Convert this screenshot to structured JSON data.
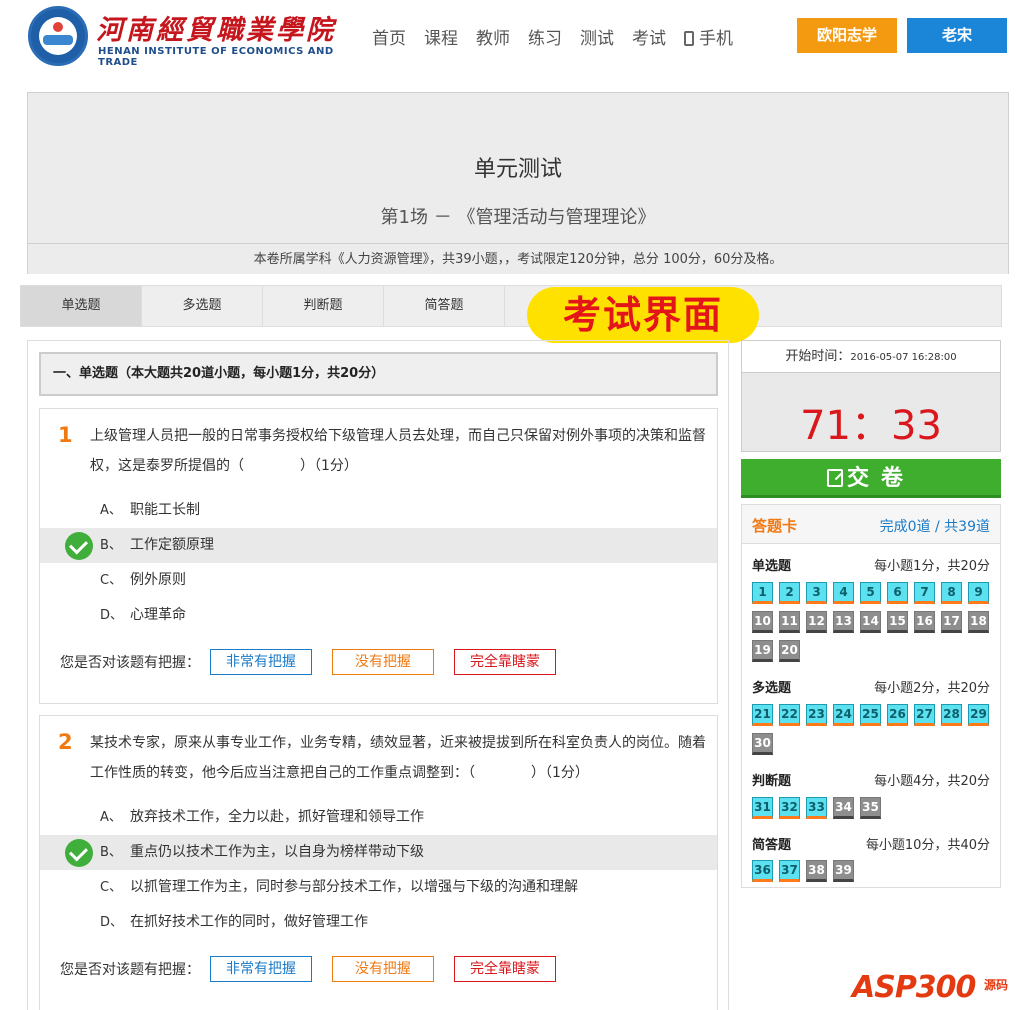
{
  "header": {
    "logo_cn": "河南經貿職業學院",
    "logo_en": "HENAN INSTITUTE OF ECONOMICS AND TRADE",
    "nav": [
      "首页",
      "课程",
      "教师",
      "练习",
      "测试",
      "考试",
      "手机"
    ],
    "user_btn1": "欧阳志学",
    "user_btn2": "老宋",
    "accent_orange": "#f39a11",
    "accent_blue": "#1b86d8"
  },
  "exam": {
    "title": "单元测试",
    "subtitle": "第1场 － 《管理活动与管理理论》",
    "info": "本卷所属学科《人力资源管理》，共39小题，，考试限定120分钟，总分 100分，60分及格。"
  },
  "tabs": [
    "单选题",
    "多选题",
    "判断题",
    "简答题"
  ],
  "overlay_label": "考试界面",
  "section_head": "一、单选题（本大题共20道小题，每小题1分，共20分）",
  "questions": [
    {
      "num": "1",
      "text": "上级管理人员把一般的日常事务授权给下级管理人员去处理，而自己只保留对例外事项的决策和监督权，这是泰罗所提倡的（　　　　）（1分）",
      "options": [
        {
          "letter": "A、",
          "text": "职能工长制"
        },
        {
          "letter": "B、",
          "text": "工作定额原理"
        },
        {
          "letter": "C、",
          "text": "例外原则"
        },
        {
          "letter": "D、",
          "text": "心理革命"
        }
      ]
    },
    {
      "num": "2",
      "text": "某技术专家，原来从事专业工作，业务专精，绩效显著，近来被提拔到所在科室负责人的岗位。随着工作性质的转变，他今后应当注意把自己的工作重点调整到：（　　　　）（1分）",
      "options": [
        {
          "letter": "A、",
          "text": "放弃技术工作，全力以赴，抓好管理和领导工作"
        },
        {
          "letter": "B、",
          "text": "重点仍以技术工作为主，以自身为榜样带动下级"
        },
        {
          "letter": "C、",
          "text": "以抓管理工作为主，同时参与部分技术工作，以增强与下级的沟通和理解"
        },
        {
          "letter": "D、",
          "text": "在抓好技术工作的同时，做好管理工作"
        }
      ]
    }
  ],
  "confidence": {
    "label": "您是否对该题有把握：",
    "b1": "非常有把握",
    "b2": "没有把握",
    "b3": "完全靠瞎蒙"
  },
  "timer": {
    "start_label": "开始时间：",
    "start_time": "2016-05-07 16:28:00",
    "clock": "71：33"
  },
  "submit_label": "交卷",
  "answer_card": {
    "title": "答题卡",
    "progress": "完成0道 / 共39道",
    "groups": [
      {
        "title": "单选题",
        "score": "每小题1分，共20分"
      },
      {
        "title": "多选题",
        "score": "每小题2分，共20分"
      },
      {
        "title": "判断题",
        "score": "每小题4分，共20分"
      },
      {
        "title": "简答题",
        "score": "每小题10分，共40分"
      }
    ]
  },
  "watermark": {
    "text": "ASP300",
    "small": "源码"
  }
}
